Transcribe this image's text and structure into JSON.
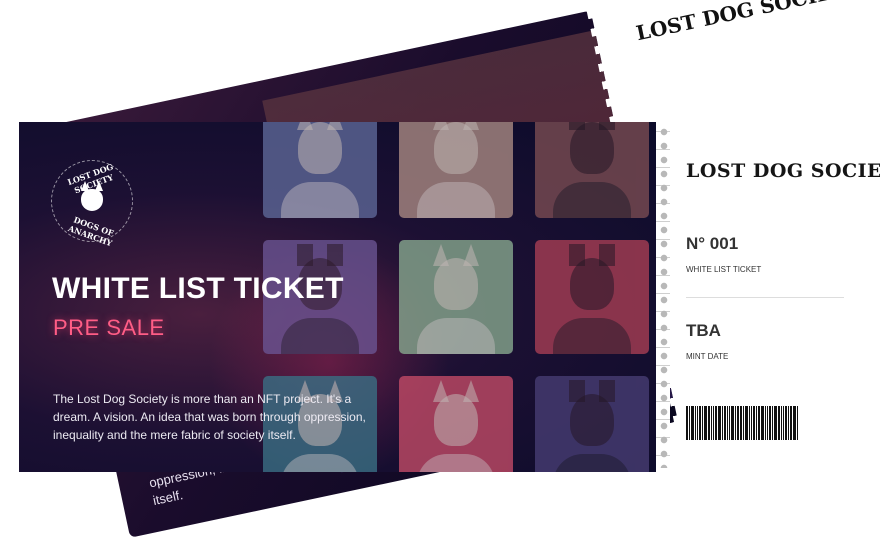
{
  "back_ticket": {
    "brand": "LOST DOG SOCIETY",
    "text": "dream. A vision. An idea that was born through oppression, inequality and the mere fabric of society itself."
  },
  "front_ticket": {
    "logo": {
      "top_text": "LOST DOG SOCIETY",
      "bottom_text": "DOGS OF ANARCHY",
      "icon": "dog-skull-icon"
    },
    "title": "WHITE LIST TICKET",
    "subtitle": "PRE SALE",
    "description": "The Lost Dog Society is more than an NFT project. It's a dream. A vision. An idea that was born through oppression, inequality and the mere fabric of society itself.",
    "tiles": [
      {
        "color": "#5d6797",
        "variant": "light"
      },
      {
        "color": "#a98982",
        "variant": "light"
      },
      {
        "color": "#7a4c52",
        "variant": "dark"
      },
      {
        "color": "#6a5492",
        "variant": "dark"
      },
      {
        "color": "#87a88e",
        "variant": "light"
      },
      {
        "color": "#a73e54",
        "variant": "dark"
      },
      {
        "color": "#3a6f84",
        "variant": "light"
      },
      {
        "color": "#c14a66",
        "variant": "light"
      },
      {
        "color": "#473d73",
        "variant": "dark"
      }
    ]
  },
  "stub": {
    "brand": "LOST DOG SOCIETY",
    "number": "N° 001",
    "number_label": "WHITE LIST TICKET",
    "mint_value": "TBA",
    "mint_label": "MINT DATE"
  },
  "colors": {
    "accent_pink": "#ff5d86",
    "ticket_dark": "#0b0b2a"
  }
}
